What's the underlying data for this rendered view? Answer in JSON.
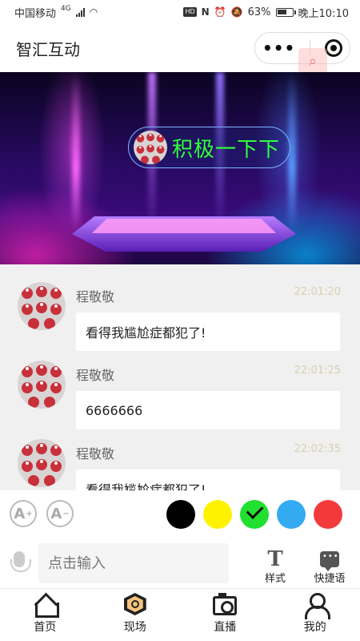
{
  "status_bar": {
    "carrier": "中国移动",
    "network": "4G",
    "battery": "63%",
    "battery_level": 0.63,
    "time": "晚上10:10",
    "hd": "HD",
    "nfc": "N"
  },
  "header": {
    "title": "智汇互动",
    "menu_icon": "more-dots-icon",
    "close_icon": "target-circle-icon",
    "float_icon": "search-icon"
  },
  "stage": {
    "barrage_text": "积极一下下"
  },
  "messages": [
    {
      "name": "程敬敬",
      "time": "22:01:20",
      "text": "看得我尴尬症都犯了!"
    },
    {
      "name": "程敬敬",
      "time": "22:01:25",
      "text": "6666666"
    },
    {
      "name": "程敬敬",
      "time": "22:02:35",
      "text": "看得我尴尬症都犯了!"
    }
  ],
  "controls": {
    "font_increase_label": "A",
    "font_decrease_label": "A",
    "font_increase_mark": "+",
    "font_decrease_mark": "−",
    "colors": [
      {
        "name": "black",
        "hex": "#000000"
      },
      {
        "name": "yellow",
        "hex": "#fff200"
      },
      {
        "name": "green",
        "hex": "#22e030"
      },
      {
        "name": "blue",
        "hex": "#33aaf2"
      },
      {
        "name": "red",
        "hex": "#f23a3a"
      }
    ],
    "selected_color": "green"
  },
  "input": {
    "placeholder": "点击输入",
    "style_label": "样式",
    "style_icon_glyph": "T",
    "quick_label": "快捷语"
  },
  "tabs": [
    {
      "label": "首页",
      "icon": "home-icon"
    },
    {
      "label": "现场",
      "icon": "hexagon-icon"
    },
    {
      "label": "直播",
      "icon": "camera-icon"
    },
    {
      "label": "我的",
      "icon": "user-icon"
    }
  ]
}
